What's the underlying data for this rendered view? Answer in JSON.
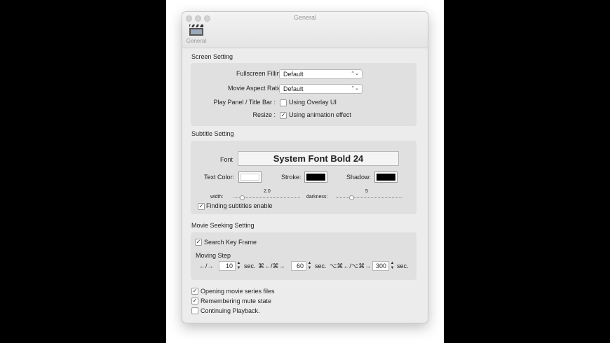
{
  "window": {
    "title": "General"
  },
  "toolbar": {
    "general_label": "General"
  },
  "screen": {
    "heading": "Screen Setting",
    "fullscreen_label": "Fullscreen Filling:",
    "fullscreen_value": "Default",
    "aspect_label": "Movie Aspect Ratio :",
    "aspect_value": "Default",
    "playpanel_label": "Play Panel / Title Bar :",
    "overlay_label": "Using Overlay UI",
    "overlay_checked": false,
    "resize_label": "Resize :",
    "animation_label": "Using animation effect",
    "animation_checked": true
  },
  "subtitle": {
    "heading": "Subtitle Setting",
    "font_label": "Font",
    "font_value": "System Font Bold 24",
    "text_color_label": "Text Color:",
    "stroke_label": "Stroke:",
    "shadow_label": "Shadow:",
    "text_color": "#ffffff",
    "stroke_color": "#000000",
    "shadow_color": "#000000",
    "width_label": "width:",
    "width_value": "2.0",
    "darkness_label": "darkness:",
    "darkness_value": "5",
    "finding_label": "Finding subtitles enable",
    "finding_checked": true
  },
  "seeking": {
    "heading": "Movie Seeking Setting",
    "keyframe_label": "Search Key Frame",
    "keyframe_checked": true,
    "moving_step_label": "Moving Step",
    "step1_keys": "←/→",
    "step1_value": "10",
    "step2_keys": "⌘←/⌘→",
    "step2_value": "60",
    "step3_keys": "⌥⌘←/⌥⌘→",
    "step3_value": "300",
    "sec_unit": "sec."
  },
  "misc": {
    "series_label": "Opening movie series files",
    "series_checked": true,
    "mute_label": "Remembering mute state",
    "mute_checked": true,
    "continue_label": "Continuing Playback.",
    "continue_checked": false
  },
  "icons": {
    "close": "traffic-light-close",
    "minimize": "traffic-light-minimize",
    "zoom": "traffic-light-zoom",
    "general": "clapperboard-icon",
    "popup_arrows": "updown-chevron-icon",
    "check": "checkmark-icon"
  },
  "glyphs": {
    "check": "✓",
    "updown": "⌃⌄",
    "up": "▲",
    "down": "▼"
  }
}
